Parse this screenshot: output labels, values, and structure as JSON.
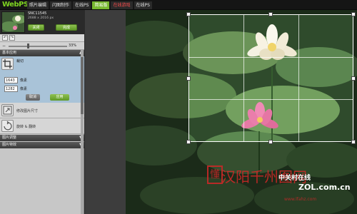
{
  "app": {
    "logo": "WebPS"
  },
  "nav": [
    {
      "label": "照片编辑",
      "state": "normal"
    },
    {
      "label": "闪图制作",
      "state": "normal"
    },
    {
      "label": "在线PS",
      "state": "normal"
    },
    {
      "label": "简易版",
      "state": "active"
    },
    {
      "label": "在线游戏",
      "state": "highlight"
    },
    {
      "label": "在线PS",
      "state": "normal"
    }
  ],
  "file": {
    "name": "SNC11545",
    "size": "2688 x 2016 px",
    "close_label": "关闭",
    "done_label": "完成"
  },
  "zoom": {
    "value": "33%",
    "fraction": 0.33
  },
  "sections": {
    "basic": "基本应用",
    "adjust": "图片调整",
    "effects": "图片特效"
  },
  "crop": {
    "title": "裁切",
    "width": "1643",
    "height": "1282",
    "unit": "像素",
    "cancel_label": "取消",
    "apply_label": "应用"
  },
  "tools": [
    {
      "label": "修改图片尺寸"
    },
    {
      "label": "旋转 & 翻转"
    }
  ],
  "watermark": {
    "brand": "中关村在线",
    "url": "ZOL.com.cn",
    "small": "www.lfahz.com"
  },
  "colors": {
    "accent": "#77b82f",
    "logo": "#7ed321",
    "hot": "#ff4d4d"
  }
}
